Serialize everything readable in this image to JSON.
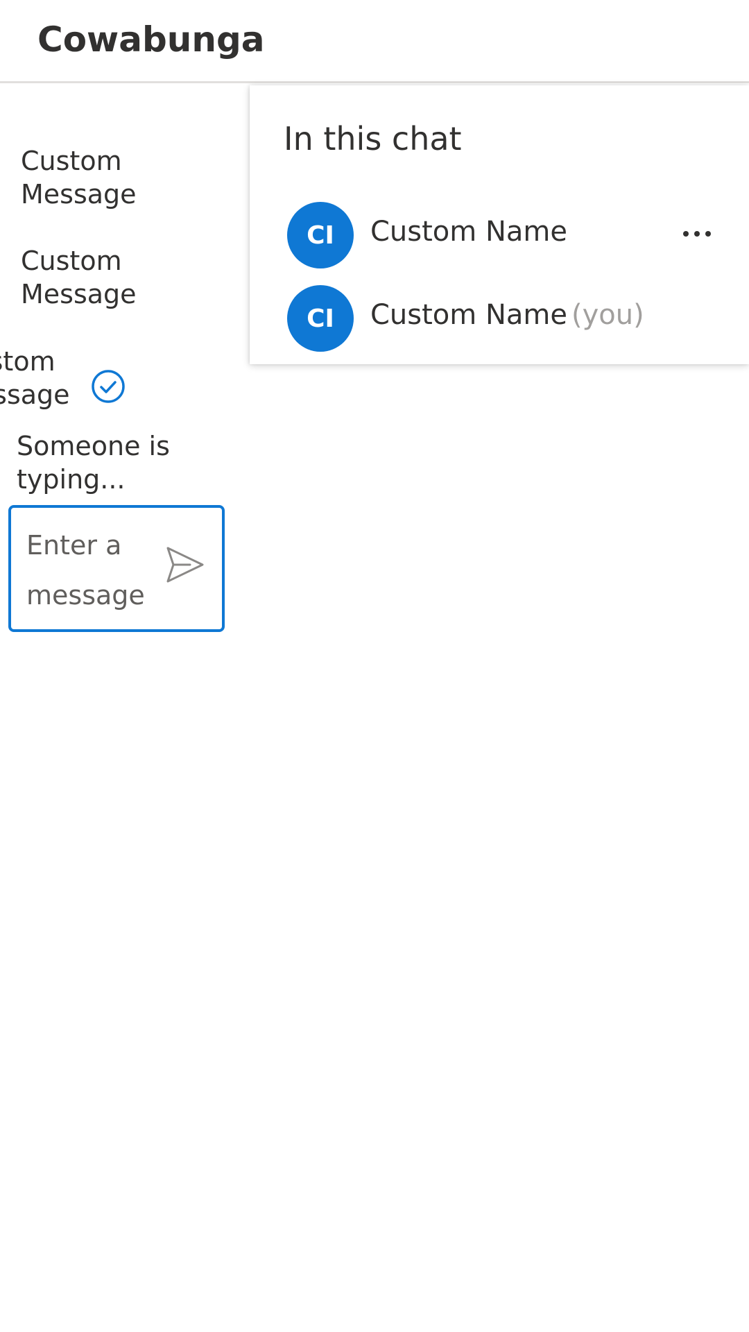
{
  "header": {
    "title": "Cowabunga"
  },
  "chat": {
    "messages": [
      {
        "text": "Custom Message"
      },
      {
        "text": "Custom Message"
      },
      {
        "text": "Custom Message",
        "status": "read"
      }
    ],
    "typing_indicator": "Someone is typing...",
    "composer": {
      "placeholder": "Enter a message",
      "value": ""
    }
  },
  "people_panel": {
    "title": "In this chat",
    "participants": [
      {
        "initials": "CI",
        "name": "Custom Name",
        "you_label": ""
      },
      {
        "initials": "CI",
        "name": "Custom Name",
        "you_label": "(you)"
      }
    ]
  },
  "colors": {
    "accent": "#0f78d4",
    "text": "#323130",
    "muted": "#a19f9d"
  },
  "icons": {
    "send": "send-icon",
    "read_receipt": "check-circle-icon",
    "more": "more-horizontal-icon"
  }
}
